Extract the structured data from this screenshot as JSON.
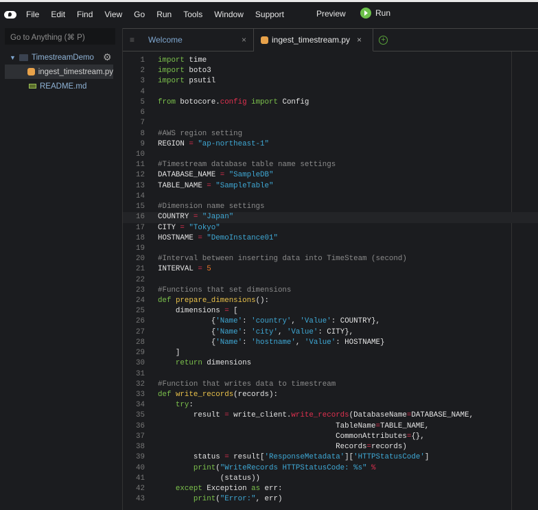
{
  "menubar": {
    "items": [
      "File",
      "Edit",
      "Find",
      "View",
      "Go",
      "Run",
      "Tools",
      "Window",
      "Support"
    ],
    "preview": "Preview",
    "run": "Run"
  },
  "sidebar": {
    "goto_placeholder": "Go to Anything (⌘ P)",
    "folder": "TimestreamDemo",
    "files": [
      "ingest_timestream.py",
      "README.md"
    ]
  },
  "tabs": [
    {
      "label": "Welcome"
    },
    {
      "label": "ingest_timestream.py",
      "active": true
    }
  ],
  "colors": {
    "keyword": "#7cc24c",
    "string": "#3fa9d6",
    "function": "#e9c14a",
    "operator": "#e0304f",
    "comment": "#8b8b8b",
    "number": "#ef7b2a"
  },
  "code": [
    [
      [
        "k",
        "import"
      ],
      [
        "p",
        " time"
      ]
    ],
    [
      [
        "k",
        "import"
      ],
      [
        "p",
        " boto3"
      ]
    ],
    [
      [
        "k",
        "import"
      ],
      [
        "p",
        " psutil"
      ]
    ],
    [],
    [
      [
        "k",
        "from"
      ],
      [
        "p",
        " botocore."
      ],
      [
        "m",
        "config"
      ],
      [
        "p",
        " "
      ],
      [
        "k",
        "import"
      ],
      [
        "p",
        " Config"
      ]
    ],
    [],
    [],
    [
      [
        "c",
        "#AWS region setting"
      ]
    ],
    [
      [
        "p",
        "REGION "
      ],
      [
        "o",
        "="
      ],
      [
        "p",
        " "
      ],
      [
        "s",
        "\"ap-northeast-1\""
      ]
    ],
    [],
    [
      [
        "c",
        "#Timestream database table name settings"
      ]
    ],
    [
      [
        "p",
        "DATABASE_NAME "
      ],
      [
        "o",
        "="
      ],
      [
        "p",
        " "
      ],
      [
        "s",
        "\"SampleDB\""
      ]
    ],
    [
      [
        "p",
        "TABLE_NAME "
      ],
      [
        "o",
        "="
      ],
      [
        "p",
        " "
      ],
      [
        "s",
        "\"SampleTable\""
      ]
    ],
    [],
    [
      [
        "c",
        "#Dimension name settings"
      ]
    ],
    [
      [
        "p",
        "COUNTRY "
      ],
      [
        "o",
        "="
      ],
      [
        "p",
        " "
      ],
      [
        "s",
        "\"Japan\""
      ]
    ],
    [
      [
        "p",
        "CITY "
      ],
      [
        "o",
        "="
      ],
      [
        "p",
        " "
      ],
      [
        "s",
        "\"Tokyo\""
      ]
    ],
    [
      [
        "p",
        "HOSTNAME "
      ],
      [
        "o",
        "="
      ],
      [
        "p",
        " "
      ],
      [
        "s",
        "\"DemoInstance01\""
      ]
    ],
    [],
    [
      [
        "c",
        "#Interval between inserting data into TimeSteam (second)"
      ]
    ],
    [
      [
        "p",
        "INTERVAL "
      ],
      [
        "o",
        "="
      ],
      [
        "p",
        " "
      ],
      [
        "n",
        "5"
      ]
    ],
    [],
    [
      [
        "c",
        "#Functions that set dimensions"
      ]
    ],
    [
      [
        "k",
        "def"
      ],
      [
        "p",
        " "
      ],
      [
        "f",
        "prepare_dimensions"
      ],
      [
        "p",
        "():"
      ]
    ],
    [
      [
        "p",
        "    dimensions "
      ],
      [
        "o",
        "="
      ],
      [
        "p",
        " ["
      ]
    ],
    [
      [
        "p",
        "            {"
      ],
      [
        "s",
        "'Name'"
      ],
      [
        "p",
        ": "
      ],
      [
        "s",
        "'country'"
      ],
      [
        "p",
        ", "
      ],
      [
        "s",
        "'Value'"
      ],
      [
        "p",
        ": COUNTRY},"
      ]
    ],
    [
      [
        "p",
        "            {"
      ],
      [
        "s",
        "'Name'"
      ],
      [
        "p",
        ": "
      ],
      [
        "s",
        "'city'"
      ],
      [
        "p",
        ", "
      ],
      [
        "s",
        "'Value'"
      ],
      [
        "p",
        ": CITY},"
      ]
    ],
    [
      [
        "p",
        "            {"
      ],
      [
        "s",
        "'Name'"
      ],
      [
        "p",
        ": "
      ],
      [
        "s",
        "'hostname'"
      ],
      [
        "p",
        ", "
      ],
      [
        "s",
        "'Value'"
      ],
      [
        "p",
        ": HOSTNAME}"
      ]
    ],
    [
      [
        "p",
        "    ]"
      ]
    ],
    [
      [
        "p",
        "    "
      ],
      [
        "k",
        "return"
      ],
      [
        "p",
        " dimensions"
      ]
    ],
    [],
    [
      [
        "c",
        "#Function that writes data to timestream"
      ]
    ],
    [
      [
        "k",
        "def"
      ],
      [
        "p",
        " "
      ],
      [
        "f",
        "write_records"
      ],
      [
        "p",
        "(records):"
      ]
    ],
    [
      [
        "p",
        "    "
      ],
      [
        "k",
        "try"
      ],
      [
        "p",
        ":"
      ]
    ],
    [
      [
        "p",
        "        result "
      ],
      [
        "o",
        "="
      ],
      [
        "p",
        " write_client."
      ],
      [
        "m",
        "write_records"
      ],
      [
        "p",
        "(DatabaseName"
      ],
      [
        "o",
        "="
      ],
      [
        "p",
        "DATABASE_NAME,"
      ]
    ],
    [
      [
        "p",
        "                                        TableName"
      ],
      [
        "o",
        "="
      ],
      [
        "p",
        "TABLE_NAME,"
      ]
    ],
    [
      [
        "p",
        "                                        CommonAttributes"
      ],
      [
        "o",
        "="
      ],
      [
        "p",
        "{},"
      ]
    ],
    [
      [
        "p",
        "                                        Records"
      ],
      [
        "o",
        "="
      ],
      [
        "p",
        "records)"
      ]
    ],
    [
      [
        "p",
        "        status "
      ],
      [
        "o",
        "="
      ],
      [
        "p",
        " result["
      ],
      [
        "s",
        "'ResponseMetadata'"
      ],
      [
        "p",
        "]["
      ],
      [
        "s",
        "'HTTPStatusCode'"
      ],
      [
        "p",
        "]"
      ]
    ],
    [
      [
        "p",
        "        "
      ],
      [
        "k",
        "print"
      ],
      [
        "p",
        "("
      ],
      [
        "s",
        "\"WriteRecords HTTPStatusCode: %s\""
      ],
      [
        "p",
        " "
      ],
      [
        "o",
        "%"
      ]
    ],
    [
      [
        "p",
        "              (status))"
      ]
    ],
    [
      [
        "p",
        "    "
      ],
      [
        "k",
        "except"
      ],
      [
        "p",
        " Exception "
      ],
      [
        "k",
        "as"
      ],
      [
        "p",
        " err:"
      ]
    ],
    [
      [
        "p",
        "        "
      ],
      [
        "k",
        "print"
      ],
      [
        "p",
        "("
      ],
      [
        "s",
        "\"Error:\""
      ],
      [
        "p",
        ", err)"
      ]
    ]
  ],
  "highlighted_line": 16
}
